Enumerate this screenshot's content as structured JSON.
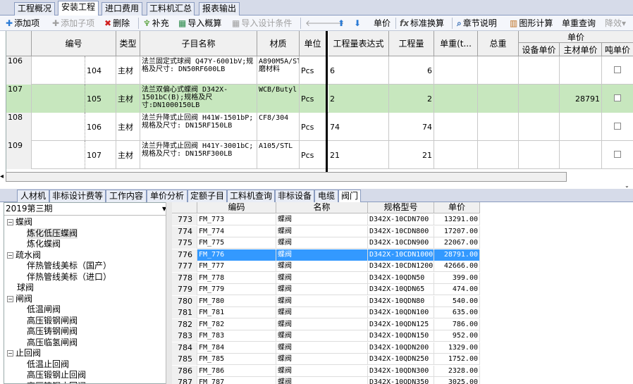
{
  "top_tabs": [
    {
      "label": "工程概况"
    },
    {
      "label": "安装工程",
      "active": true
    },
    {
      "label": "进口费用"
    },
    {
      "label": "工料机汇总"
    },
    {
      "label": "报表输出"
    }
  ],
  "toolbar": {
    "add_item": "添加项",
    "add_sub": "添加子项",
    "delete": "删除",
    "supplement": "补充",
    "import_budget": "导入概算",
    "import_design": "导入设计条件",
    "unit_price": "单价",
    "std_convert": "标准换算",
    "chapter_note": "章节说明",
    "graphic_calc": "图形计算",
    "unit_weight_query": "单重查询",
    "fx_glyph": "fx",
    "more": "降效"
  },
  "grid": {
    "headers": {
      "code": "编号",
      "type": "类型",
      "name": "子目名称",
      "material": "材质",
      "unit": "单位",
      "expr": "工程量表达式",
      "qty": "工程量",
      "unit_weight": "单重(t...",
      "total_weight": "总重",
      "unit_price_group": "单价",
      "equip_price": "设备单价",
      "main_mat_price": "主材单价",
      "ton_price": "吨单价"
    },
    "rows": [
      {
        "row": "106",
        "code": "104",
        "type": "主材",
        "name": "法兰固定式球阀 Q47Y-6001bV;规格及尺寸: DN50RF600LB",
        "material": "A890M5A/STL+耐磨材料",
        "unit": "Pcs",
        "expr": "6",
        "qty": "6",
        "main_price": ""
      },
      {
        "row": "107",
        "code": "105",
        "type": "主材",
        "name": "法兰双偏心式蝶阀 D342X-1501bC(B);规格及尺寸:DN1000150LB",
        "material": "WCB/Butyl",
        "unit": "Pcs",
        "expr": "2",
        "qty": "2",
        "main_price": "28791",
        "selected": true
      },
      {
        "row": "108",
        "code": "106",
        "type": "主材",
        "name": "法兰升降式止回阀 H41W-1501bP;规格及尺寸: DN15RF150LB",
        "material": "CF8/304",
        "unit": "Pcs",
        "expr": "74",
        "qty": "74",
        "main_price": ""
      },
      {
        "row": "109",
        "code": "107",
        "type": "主材",
        "name": "法兰升降式止回阀 H41Y-3001bC;规格及尺寸: DN15RF300LB",
        "material": "A105/STL",
        "unit": "Pcs",
        "expr": "21",
        "qty": "21",
        "main_price": ""
      }
    ]
  },
  "bottom_tabs": [
    {
      "label": "人材机"
    },
    {
      "label": "非标设计费等"
    },
    {
      "label": "工作内容"
    },
    {
      "label": "单价分析"
    },
    {
      "label": "定额子目"
    },
    {
      "label": "工料机查询"
    },
    {
      "label": "非标设备"
    },
    {
      "label": "电缆"
    },
    {
      "label": "阀门",
      "active": true
    }
  ],
  "left_panel": {
    "period": "2019第三期",
    "tree": [
      {
        "label": "蝶阀",
        "level": 0,
        "exp": "⊟"
      },
      {
        "label": "炼化低压蝶阀",
        "level": 1,
        "selected": true
      },
      {
        "label": "炼化蝶阀",
        "level": 1
      },
      {
        "label": "疏水阀",
        "level": 0,
        "exp": "⊟"
      },
      {
        "label": "伴热管线美标（国产）",
        "level": 1
      },
      {
        "label": "伴热管线美标（进口）",
        "level": 1
      },
      {
        "label": "球阀",
        "level": 0
      },
      {
        "label": "闸阀",
        "level": 0,
        "exp": "⊟"
      },
      {
        "label": "低温闸阀",
        "level": 1
      },
      {
        "label": "高压锻钢闸阀",
        "level": 1
      },
      {
        "label": "高压铸钢闸阀",
        "level": 1
      },
      {
        "label": "高压临氢闸阀",
        "level": 1
      },
      {
        "label": "止回阀",
        "level": 0,
        "exp": "⊟"
      },
      {
        "label": "低温止回阀",
        "level": 1
      },
      {
        "label": "高压锻钢止回阀",
        "level": 1
      },
      {
        "label": "高压铸钢止回阀",
        "level": 1
      }
    ]
  },
  "right_panel": {
    "headers": {
      "code": "编码",
      "name": "名称",
      "spec": "规格型号",
      "price": "单价"
    },
    "rows": [
      {
        "idx": "773",
        "code": "FM_773",
        "name": "蝶阀",
        "spec": "D342X-10CDN700",
        "price": "13291.00"
      },
      {
        "idx": "774",
        "code": "FM_774",
        "name": "蝶阀",
        "spec": "D342X-10CDN800",
        "price": "17207.00"
      },
      {
        "idx": "775",
        "code": "FM_775",
        "name": "蝶阀",
        "spec": "D342X-10CDN900",
        "price": "22067.00"
      },
      {
        "idx": "776",
        "code": "FM_776",
        "name": "蝶阀",
        "spec": "D342X-10CDN1000",
        "price": "28791.00",
        "selected": true
      },
      {
        "idx": "777",
        "code": "FM_777",
        "name": "蝶阀",
        "spec": "D342X-10CDN1200",
        "price": "42666.00"
      },
      {
        "idx": "778",
        "code": "FM_778",
        "name": "蝶阀",
        "spec": "D342X-10QDN50",
        "price": "399.00"
      },
      {
        "idx": "779",
        "code": "FM_779",
        "name": "蝶阀",
        "spec": "D342X-10QDN65",
        "price": "474.00"
      },
      {
        "idx": "780",
        "code": "FM_780",
        "name": "蝶阀",
        "spec": "D342X-10QDN80",
        "price": "540.00"
      },
      {
        "idx": "781",
        "code": "FM_781",
        "name": "蝶阀",
        "spec": "D342X-10QDN100",
        "price": "635.00"
      },
      {
        "idx": "782",
        "code": "FM_782",
        "name": "蝶阀",
        "spec": "D342X-10QDN125",
        "price": "786.00"
      },
      {
        "idx": "783",
        "code": "FM_783",
        "name": "蝶阀",
        "spec": "D342X-10QDN150",
        "price": "952.00"
      },
      {
        "idx": "784",
        "code": "FM_784",
        "name": "蝶阀",
        "spec": "D342X-10QDN200",
        "price": "1329.00"
      },
      {
        "idx": "785",
        "code": "FM_785",
        "name": "蝶阀",
        "spec": "D342X-10QDN250",
        "price": "1752.00"
      },
      {
        "idx": "786",
        "code": "FM_786",
        "name": "蝶阀",
        "spec": "D342X-10QDN300",
        "price": "2328.00"
      },
      {
        "idx": "787",
        "code": "FM_787",
        "name": "蝶阀",
        "spec": "D342X-10QDN350",
        "price": "3025.00"
      }
    ]
  },
  "colors": {
    "selected_row": "#c7e7be",
    "list_selection": "#3399ff",
    "tab_bar": "#d6dbe9"
  }
}
